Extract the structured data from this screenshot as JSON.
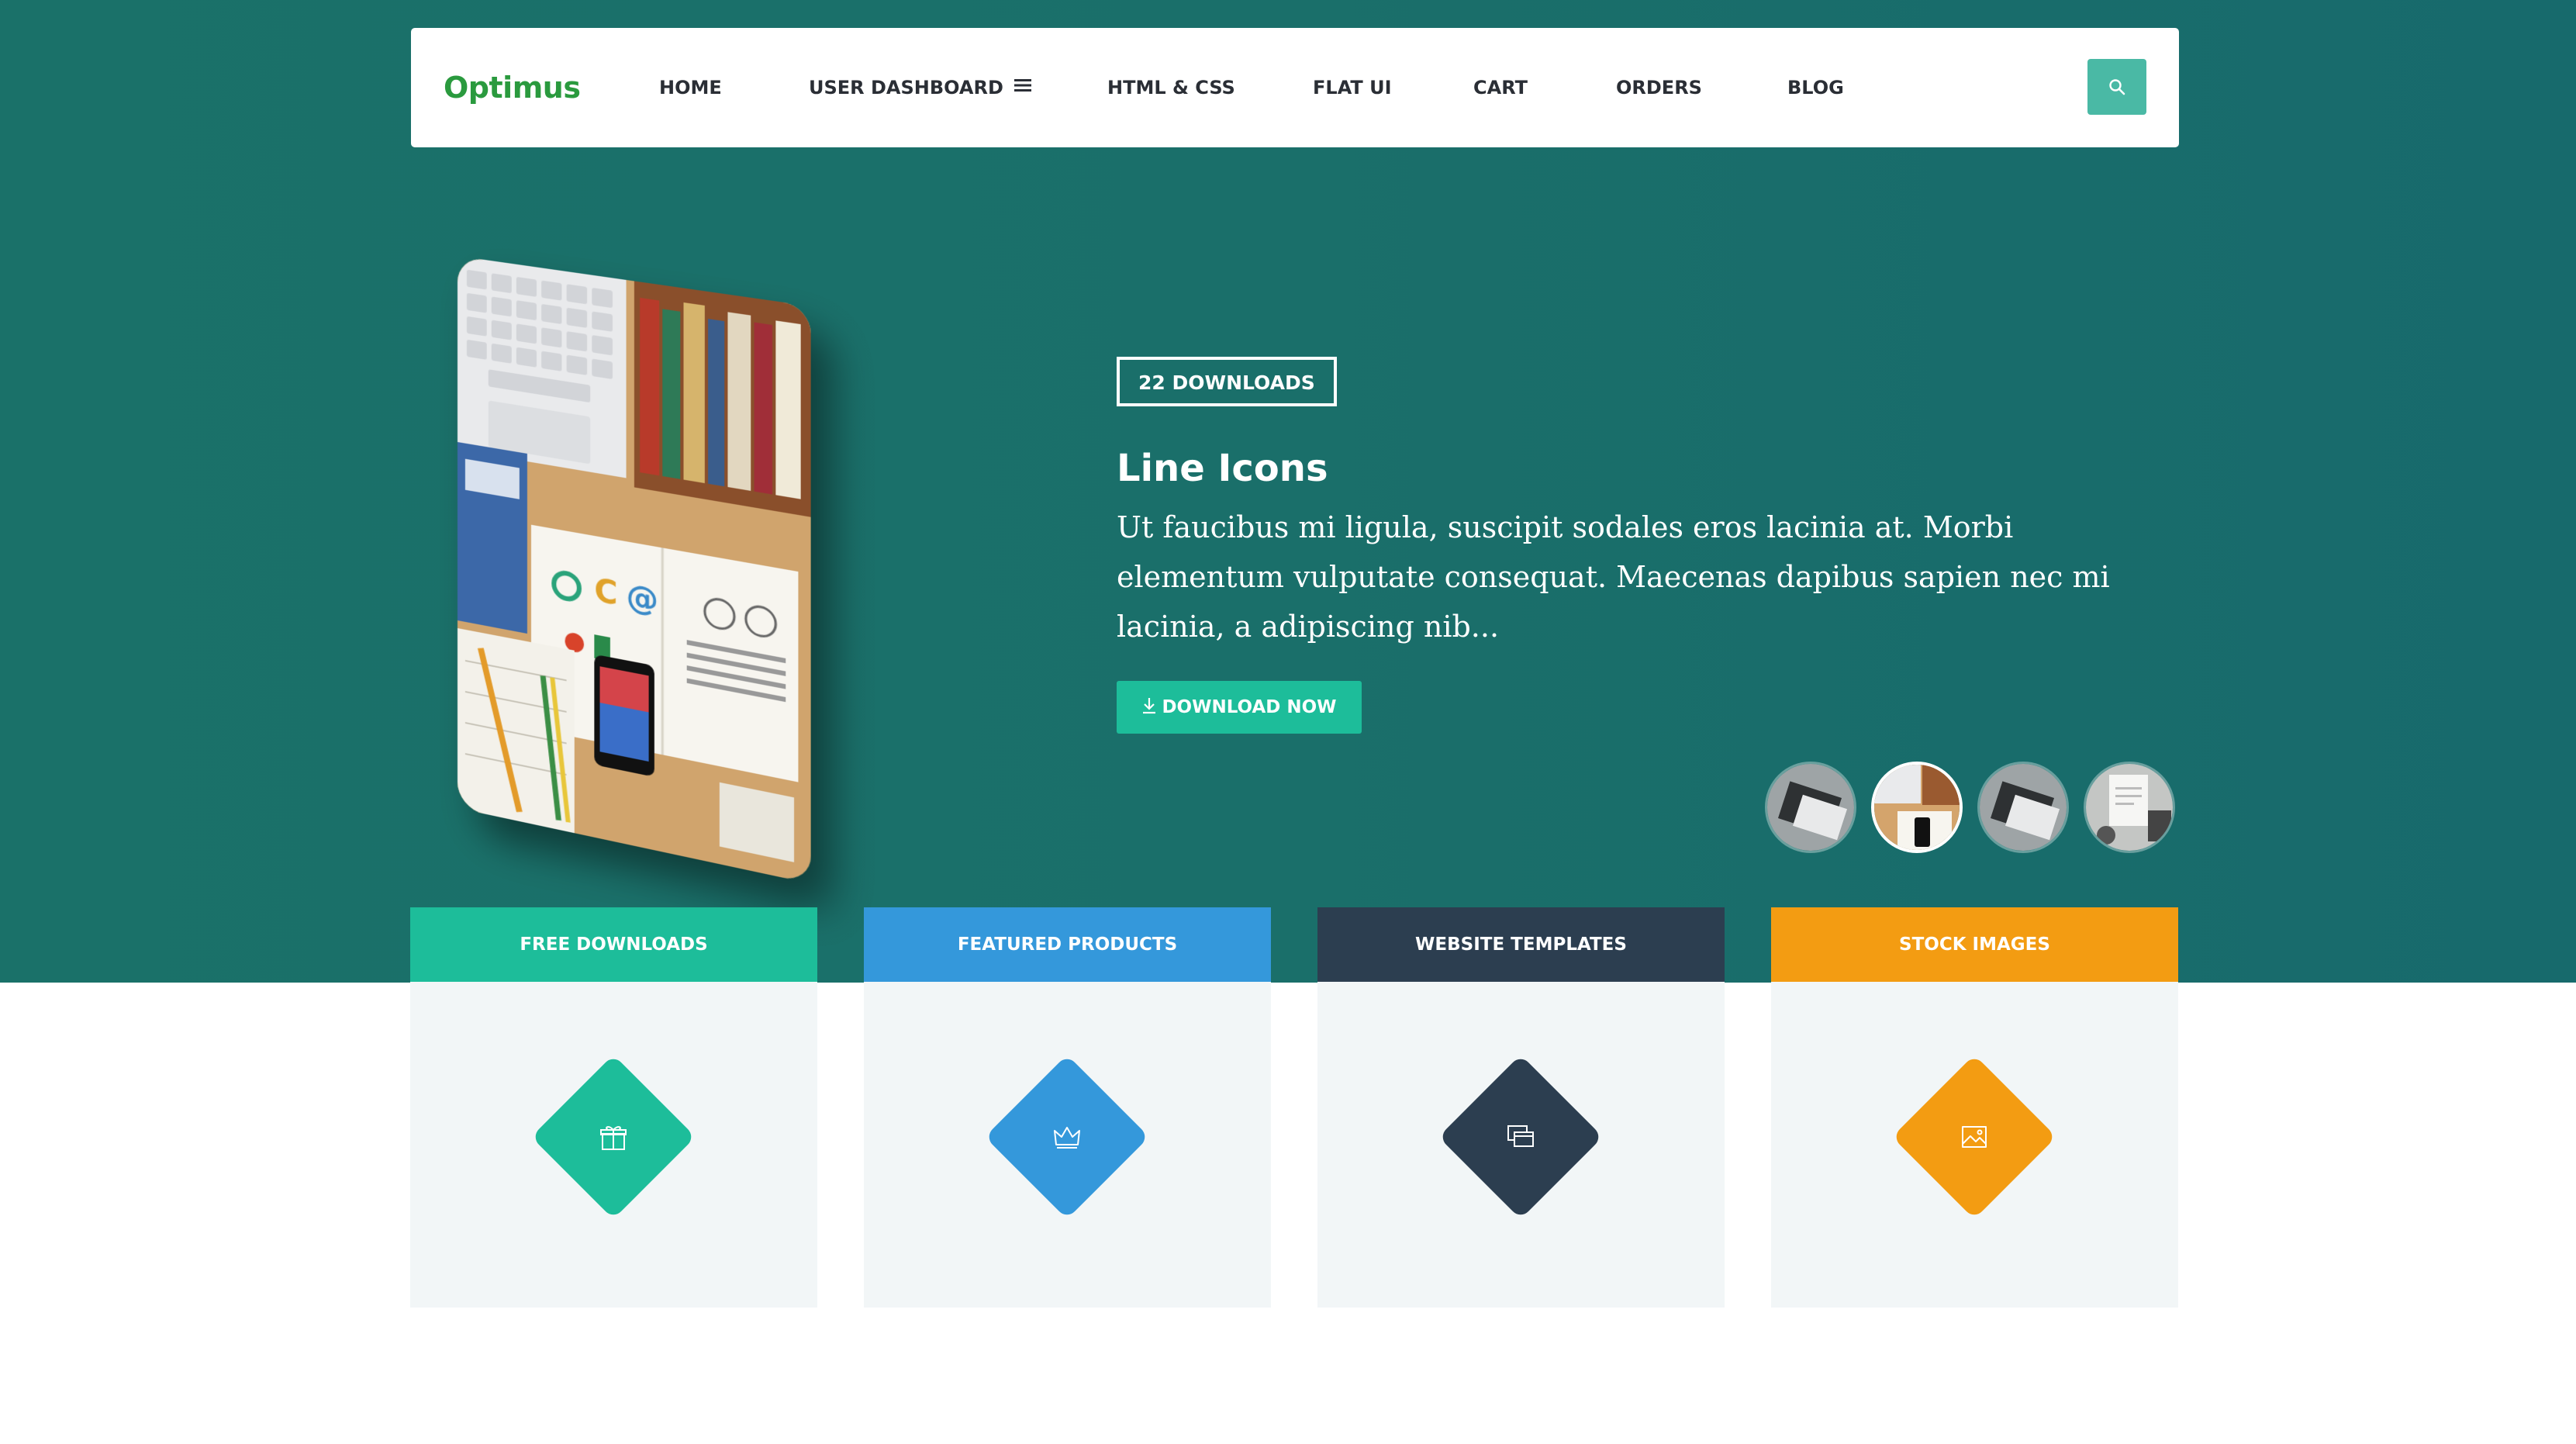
{
  "navbar": {
    "brand": "Optimus",
    "items": [
      {
        "label": "HOME"
      },
      {
        "label": "USER DASHBOARD"
      },
      {
        "label": "HTML & CSS"
      },
      {
        "label": "FLAT UI"
      },
      {
        "label": "CART"
      },
      {
        "label": "ORDERS"
      },
      {
        "label": "BLOG"
      }
    ],
    "search_icon": "search-icon"
  },
  "hero": {
    "badge": "22 DOWNLOADS",
    "title": "Line Icons",
    "description": "Ut faucibus mi ligula, suscipit sodales eros lacinia at. Morbi elementum vulputate consequat. Maecenas dapibus sapien nec mi lacinia, a adipiscing nib...",
    "button_label": "DOWNLOAD NOW",
    "button_icon": "download-icon",
    "thumbnails_count_active_index": 1
  },
  "categories": [
    {
      "label": "FREE DOWNLOADS",
      "color": "#1dbd9a",
      "icon": "gift-icon"
    },
    {
      "label": "FEATURED PRODUCTS",
      "color": "#3498db",
      "icon": "crown-icon"
    },
    {
      "label": "WEBSITE TEMPLATES",
      "color": "#2c3e50",
      "icon": "windows-icon"
    },
    {
      "label": "STOCK IMAGES",
      "color": "#f39c12",
      "icon": "image-icon"
    }
  ],
  "colors": {
    "hero_bg": "#1a7169",
    "accent": "#1dbd9a",
    "search_button": "#4ab9a5",
    "brand": "#2a9a3e"
  }
}
